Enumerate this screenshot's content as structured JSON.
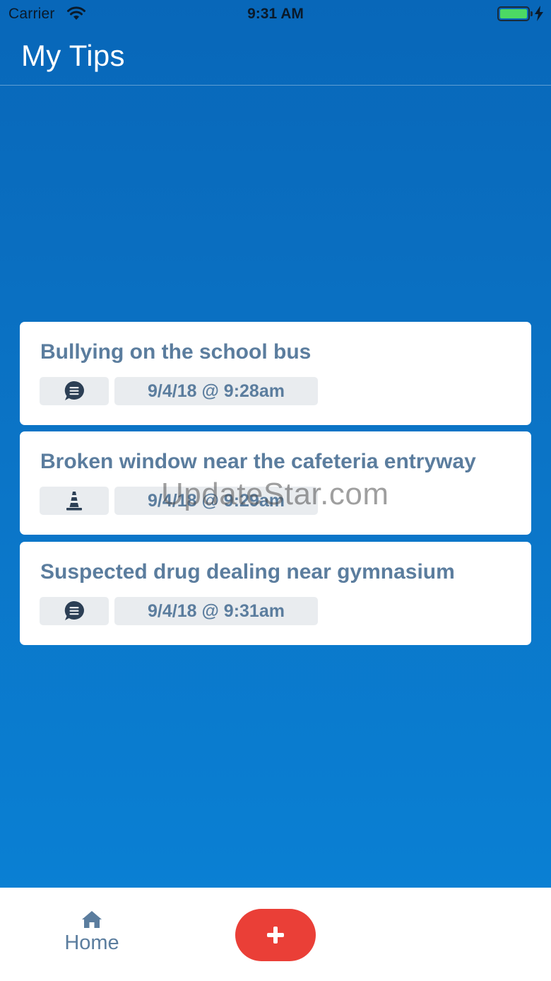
{
  "status_bar": {
    "carrier": "Carrier",
    "time": "9:31 AM",
    "battery_level": 1.0
  },
  "header": {
    "title": "My Tips"
  },
  "tips": [
    {
      "title": "Bullying on the school bus",
      "type_icon": "chat-bubble-icon",
      "date": "9/4/18 @ 9:28am"
    },
    {
      "title": "Broken window near the cafeteria entryway",
      "type_icon": "traffic-cone-icon",
      "date": "9/4/18 @ 9:29am"
    },
    {
      "title": "Suspected drug dealing near gymnasium",
      "type_icon": "chat-bubble-icon",
      "date": "9/4/18 @ 9:31am"
    }
  ],
  "watermark": "UpdateStar.com",
  "tab_bar": {
    "home_label": "Home",
    "home_icon": "home-icon",
    "add_icon": "plus-icon"
  },
  "colors": {
    "background_top": "#0867b9",
    "background_bottom": "#0a82d6",
    "text_accent": "#5b7d9e",
    "add_button": "#ea3f37",
    "chip_bg": "#e9ecef"
  }
}
